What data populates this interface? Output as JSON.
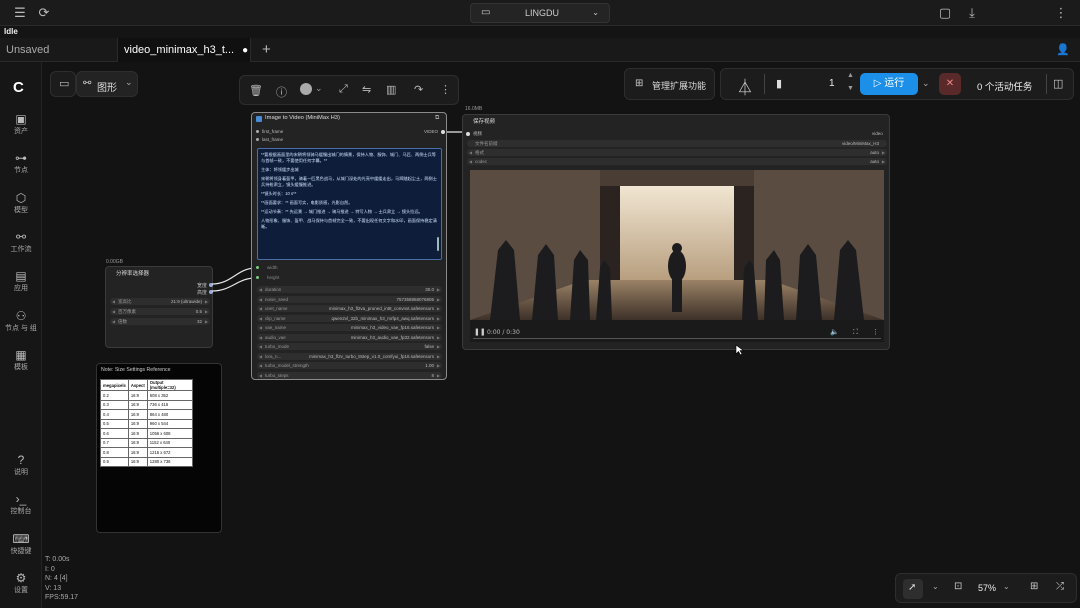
{
  "topbar": {
    "server_name": "LINGDU",
    "status": "Idle"
  },
  "tabs": [
    {
      "label": "Unsaved Workflow",
      "modified": "●"
    },
    {
      "label": "video_minimax_h3_t...",
      "modified": "●"
    }
  ],
  "tab_add": "+",
  "sidebar": {
    "items": [
      {
        "label": "资产",
        "icon": "image-icon"
      },
      {
        "label": "节点",
        "icon": "node-icon"
      },
      {
        "label": "模型",
        "icon": "cube-icon"
      },
      {
        "label": "工作流",
        "icon": "workflow-icon"
      },
      {
        "label": "应用",
        "icon": "app-icon"
      },
      {
        "label": "节点 与 组",
        "icon": "group-icon"
      },
      {
        "label": "模板",
        "icon": "template-icon"
      }
    ],
    "bottom_items": [
      {
        "label": "说明",
        "icon": "help-icon"
      },
      {
        "label": "控制台",
        "icon": "terminal-icon"
      },
      {
        "label": "快捷键",
        "icon": "keyboard-icon"
      },
      {
        "label": "设置",
        "icon": "gear-icon"
      }
    ]
  },
  "graph_button": "图形",
  "manage_extensions": "管理扩展功能",
  "queue": {
    "count": "1",
    "run_label": "运行",
    "active_tasks": "0 个活动任务"
  },
  "colors": {
    "accent": "#1c8fe8",
    "cancel_bg": "#5a2a2a"
  },
  "nodes": {
    "resolution": {
      "id": "0.00GB",
      "title": "分辨率选择器",
      "outputs": [
        "宽度",
        "高度"
      ],
      "widgets": [
        {
          "name": "宽高比",
          "value": "21:9 (ultrawide)"
        },
        {
          "name": "百万像素",
          "value": "0.5"
        },
        {
          "name": "倍数",
          "value": "32"
        }
      ]
    },
    "i2v": {
      "title": "Image to Video (MiniMax H3)",
      "inputs": [
        "first_frame",
        "last_frame"
      ],
      "output": "VIDEO",
      "prompt_lines": [
        "**要根据画面里的宋朝将领骑马缓慢出城门的情景，保持人物、服饰、城门、马匹、两侧士兵等与首帧一致，不要使用任何字幕。**",
        "主体：将领缓步出城",
        "宋朝将领身着盔甲，骑着一匹黑色战马，从城门深处的光亮中缓缓走出，马蹄踏起尘土，两侧士兵持枪肃立，镜头缓慢推进。",
        "**镜头时长：10 s**",
        "**画面要求：** 画面写实，电影质感，光影自然。",
        "**运动节奏：** 先远景 → 城门推进 → 骑马推进 → 特写人物 → 士兵肃立 → 镜头拉远。",
        "人物形象、服饰、盔甲、战马保持与首帧完全一致，不要出现任何文字和水印，画面保持稳定清晰。"
      ],
      "slots": [
        "width",
        "height"
      ],
      "widgets": [
        {
          "name": "duration",
          "value": "30.0"
        },
        {
          "name": "noise_seed",
          "value": "757358868076805"
        },
        {
          "name": "unet_name",
          "value": "minimax_h3_fl2va_pruned_int8_convnxt.safetensors"
        },
        {
          "name": "clip_name",
          "value": "qwen2vl_32b_minimax_h3_mrfp4_awq.safetensors"
        },
        {
          "name": "vae_name",
          "value": "minimax_h3_video_vae_fp16.safetensors"
        },
        {
          "name": "audio_vae",
          "value": "minimax_h3_audio_vae_fp32.safetensors"
        },
        {
          "name": "turbo_mode",
          "value": "false"
        },
        {
          "name": "lora_n...",
          "value": "minimax_h3_fl2v_turbo_8step_v1.0_comfyui_fp16.safetensors"
        },
        {
          "name": "turbo_model_strength",
          "value": "1.00"
        },
        {
          "name": "turbo_steps",
          "value": "8"
        }
      ]
    },
    "save_video": {
      "id": "16.0MB",
      "title": "保存视频",
      "input": "视频",
      "output": "video",
      "widgets": [
        {
          "name": "文件名前缀",
          "value": "video/MiniMax_H3"
        },
        {
          "name": "格式",
          "value": "auto"
        },
        {
          "name": "codec",
          "value": "auto"
        }
      ],
      "video_time": "0:00 / 0:30"
    },
    "note": {
      "title": "Note: Size Settings Reference",
      "headers": [
        "megapixels",
        "Aspect",
        "Output (multiple=32)"
      ],
      "rows": [
        [
          "0.2",
          "16:9",
          "608 x 352"
        ],
        [
          "0.3",
          "16:9",
          "736 x 416"
        ],
        [
          "0.4",
          "16:9",
          "864 x 480"
        ],
        [
          "0.5",
          "16:9",
          "960 x 544"
        ],
        [
          "0.6",
          "16:9",
          "1056 x 608"
        ],
        [
          "0.7",
          "16:9",
          "1152 x 640"
        ],
        [
          "0.8",
          "16:9",
          "1216 x 672"
        ],
        [
          "0.9",
          "16:9",
          "1280 x 736"
        ]
      ]
    }
  },
  "stats": {
    "t": "T: 0.00s",
    "i": "I: 0",
    "n": "N: 4 [4]",
    "v": "V: 13",
    "fps": "FPS:59.17"
  },
  "zoom": "57%"
}
